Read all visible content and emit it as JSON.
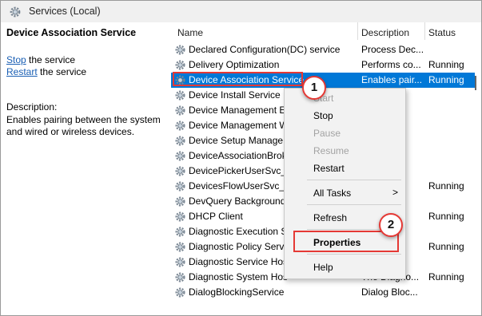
{
  "window": {
    "title": "Services (Local)",
    "icon": "gear-icon"
  },
  "left_panel": {
    "service_title": "Device Association Service",
    "stop_link": "Stop",
    "stop_suffix": " the service",
    "restart_link": "Restart",
    "restart_suffix": " the service",
    "description_label": "Description:",
    "description_text": "Enables pairing between the system and wired or wireless devices."
  },
  "table": {
    "columns": [
      "Name",
      "Description",
      "Status"
    ],
    "rows": [
      {
        "name": "Declared Configuration(DC) service",
        "description": "Process Dec...",
        "status": ""
      },
      {
        "name": "Delivery Optimization",
        "description": "Performs co...",
        "status": "Running"
      },
      {
        "name": "Device Association Service",
        "description": "Enables pair...",
        "status": "Running",
        "selected": true
      },
      {
        "name": "Device Install Service",
        "description": "",
        "status": ""
      },
      {
        "name": "Device Management E",
        "description": "",
        "status": ""
      },
      {
        "name": "Device Management W",
        "description": "",
        "status": ""
      },
      {
        "name": "Device Setup Manage",
        "description": "",
        "status": ""
      },
      {
        "name": "DeviceAssociationBrok",
        "description": "",
        "status": ""
      },
      {
        "name": "DevicePickerUserSvc_8",
        "description": "",
        "status": ""
      },
      {
        "name": "DevicesFlowUserSvc_8",
        "description": "",
        "status": "Running"
      },
      {
        "name": "DevQuery Background",
        "description": "",
        "status": ""
      },
      {
        "name": "DHCP Client",
        "description": "",
        "status": "Running"
      },
      {
        "name": "Diagnostic Execution S",
        "description": "",
        "status": ""
      },
      {
        "name": "Diagnostic Policy Serv",
        "description": "",
        "status": "Running"
      },
      {
        "name": "Diagnostic Service Hos",
        "description": "",
        "status": ""
      },
      {
        "name": "Diagnostic System Hos",
        "description": "The Diagno...",
        "status": "Running"
      },
      {
        "name": "DialogBlockingService",
        "description": "Dialog Bloc...",
        "status": ""
      }
    ]
  },
  "context_menu": {
    "start": "Start",
    "stop": "Stop",
    "pause": "Pause",
    "resume": "Resume",
    "restart": "Restart",
    "all_tasks": "All Tasks",
    "all_tasks_arrow": ">",
    "refresh": "Refresh",
    "properties": "Properties",
    "help": "Help"
  },
  "annotations": {
    "badge1": "1",
    "badge2": "2"
  },
  "colors": {
    "selection": "#0078d7",
    "highlight_red": "#e53935",
    "link": "#1a5fb4"
  }
}
